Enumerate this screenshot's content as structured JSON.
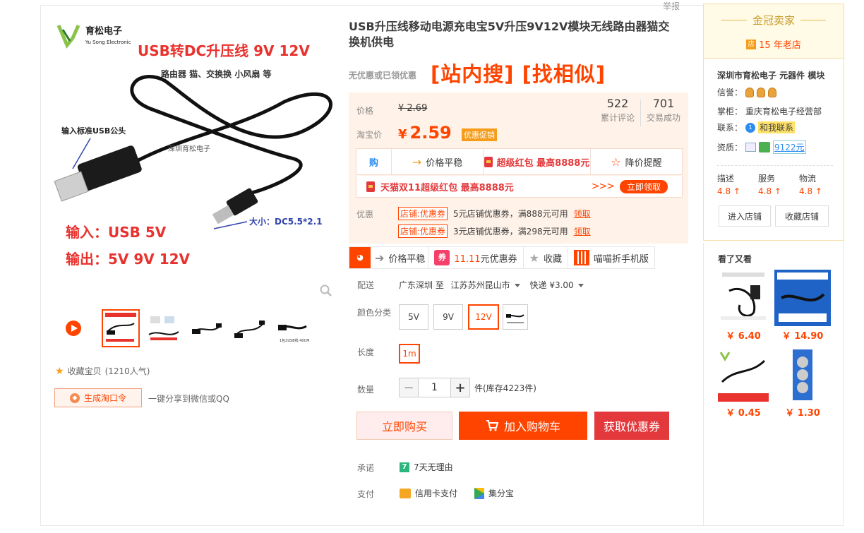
{
  "report_label": "举报",
  "product": {
    "title": "USB升压线移动电源充电宝5V升压9V12V模块无线路由器猫交换机供电",
    "subtitle": "无优惠或已领优惠",
    "search_tags": "[站内搜] [找相似]"
  },
  "gallery": {
    "brand_cn": "育松电子",
    "brand_en": "Yu Song Electronic",
    "banner": "USB转DC升压线 9V 12V",
    "usage": "路由器 猫、交换换 小风扇 等",
    "usb_label": "输入标准USB公头",
    "watermark": "深圳育松电子",
    "size_label": "大小：DC5.5*2.1",
    "input_label": "输入：USB 5V",
    "output_label": "输出：5V 9V 12V",
    "thumb_caption": "1包2USB线 40CM"
  },
  "actions": {
    "favorite": "收藏宝贝",
    "favorite_count": "(1210人气)",
    "taokou": "生成淘口令",
    "share": "一键分享到微信或QQ"
  },
  "price": {
    "label_price": "价格",
    "original": "¥ 2.69",
    "label_taobao": "淘宝价",
    "current_symbol": "¥",
    "current": "2.59",
    "promo_tag": "优惠促销",
    "reviews_count": "522",
    "reviews_label": "累计评论",
    "deals_count": "701",
    "deals_label": "交易成功"
  },
  "activity_bar": {
    "gou": "购",
    "price_stable": "价格平稳",
    "super_redpacket": "超级红包 最高8888元",
    "price_alert": "降价提醒"
  },
  "tmall_bar": {
    "text": "天猫双11超级红包 最高8888元",
    "chevrons": ">>>",
    "button": "立即领取"
  },
  "coupons": {
    "label": "优惠",
    "items": [
      {
        "tag": "店铺:优惠券",
        "text": "5元店铺优惠券，满888元可用",
        "link": "领取"
      },
      {
        "tag": "店铺:优惠券",
        "text": "3元店铺优惠券，满298元可用",
        "link": "领取"
      }
    ]
  },
  "toolbar": {
    "price_stable": "价格平稳",
    "coupon_icon": "券",
    "coupon_prefix": "11.11",
    "coupon_suffix": "元优惠券",
    "favorite": "收藏",
    "mobile": "喵喵折手机版"
  },
  "delivery": {
    "label": "配送",
    "from": "广东深圳 至",
    "to": "江苏苏州昆山市",
    "method": "快递 ¥3.00"
  },
  "color": {
    "label": "颜色分类",
    "options": [
      "5V",
      "9V",
      "12V"
    ],
    "selected": "12V"
  },
  "length": {
    "label": "长度",
    "option": "1m"
  },
  "quantity": {
    "label": "数量",
    "minus": "−",
    "value": "1",
    "plus": "+",
    "stock": "件(库存4223件)"
  },
  "buttons": {
    "buy_now": "立即购买",
    "add_cart": "加入购物车",
    "get_coupon": "获取优惠券"
  },
  "promise": {
    "label": "承诺",
    "icon": "7",
    "text": "7天无理由"
  },
  "payment": {
    "label": "支付",
    "credit": "信用卡支付",
    "jifen": "集分宝"
  },
  "shop": {
    "badge": "金冠卖家",
    "age": "15 年老店",
    "name": "深圳市育松电子 元器件 模块",
    "credit_label": "信誉：",
    "keeper_label": "掌柜：",
    "keeper": "重庆育松电子经营部",
    "contact_label": "联系：",
    "contact": "和我联系",
    "qual_label": "资质：",
    "qual_count": "9122元",
    "scores": [
      {
        "name": "描述",
        "value": "4.8 ↑"
      },
      {
        "name": "服务",
        "value": "4.8 ↑"
      },
      {
        "name": "物流",
        "value": "4.8 ↑"
      }
    ],
    "enter": "进入店铺",
    "collect": "收藏店铺"
  },
  "also_viewed": {
    "title": "看了又看",
    "items": [
      {
        "price": "￥ 6.40"
      },
      {
        "price": "￥ 14.90"
      },
      {
        "price": "￥ 0.45"
      },
      {
        "price": "￥ 1.30"
      }
    ]
  },
  "colors": {
    "accent": "#ff4400",
    "red": "#e4393c",
    "gold": "#c89b2a",
    "price_bg": "#fff2e8"
  }
}
